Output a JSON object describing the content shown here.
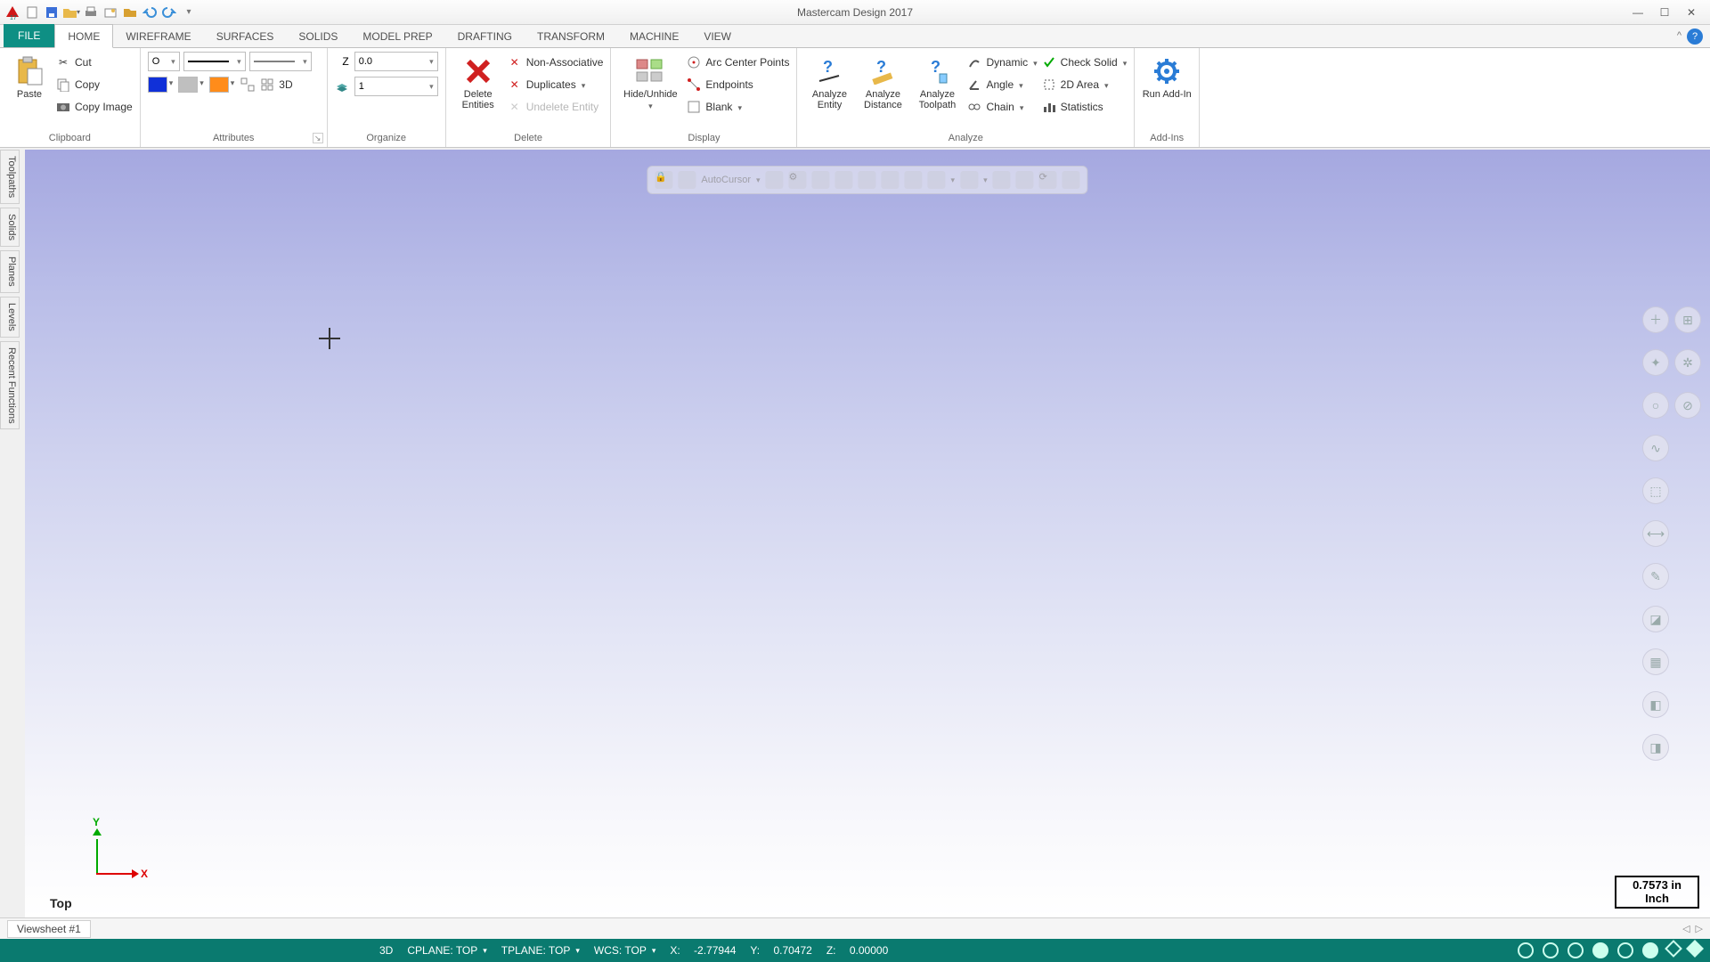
{
  "title": "Mastercam Design 2017",
  "qat": [
    "logo",
    "new",
    "save",
    "open",
    "print",
    "camera",
    "folder",
    "undo",
    "redo",
    "more"
  ],
  "win": {
    "min": "—",
    "max": "☐",
    "close": "✕"
  },
  "tabs": {
    "file": "FILE",
    "items": [
      "HOME",
      "WIREFRAME",
      "SURFACES",
      "SOLIDS",
      "MODEL PREP",
      "DRAFTING",
      "TRANSFORM",
      "MACHINE",
      "VIEW"
    ],
    "active": "HOME"
  },
  "ribbon": {
    "clipboard": {
      "label": "Clipboard",
      "paste": "Paste",
      "cut": "Cut",
      "copy": "Copy",
      "copy_image": "Copy Image"
    },
    "attributes": {
      "label": "Attributes",
      "point_style": "O",
      "threed": "3D"
    },
    "organize": {
      "label": "Organize",
      "z": "Z",
      "z_value": "0.0",
      "level_value": "1"
    },
    "delete": {
      "label": "Delete",
      "delete_entities": "Delete Entities",
      "non_assoc": "Non-Associative",
      "duplicates": "Duplicates",
      "undelete": "Undelete Entity"
    },
    "display": {
      "label": "Display",
      "hide_unhide": "Hide/Unhide",
      "arc_center": "Arc Center Points",
      "endpoints": "Endpoints",
      "blank": "Blank"
    },
    "analyze": {
      "label": "Analyze",
      "entity": "Analyze Entity",
      "distance": "Analyze Distance",
      "toolpath": "Analyze Toolpath",
      "dynamic": "Dynamic",
      "angle": "Angle",
      "chain": "Chain",
      "check_solid": "Check Solid",
      "area_2d": "2D Area",
      "statistics": "Statistics"
    },
    "addins": {
      "label": "Add-Ins",
      "run": "Run Add-In"
    }
  },
  "side_tabs": [
    "Toolpaths",
    "Solids",
    "Planes",
    "Levels",
    "Recent Functions"
  ],
  "floatbar": {
    "label": "AutoCursor"
  },
  "viewport": {
    "view_label": "Top",
    "axis_x": "X",
    "axis_y": "Y",
    "scale_value": "0.7573 in",
    "scale_unit": "Inch"
  },
  "viewsheet": {
    "tab": "Viewsheet #1"
  },
  "status": {
    "space": "",
    "mode": "3D",
    "cplane": "CPLANE: TOP",
    "tplane": "TPLANE: TOP",
    "wcs": "WCS: TOP",
    "x_label": "X:",
    "x_val": "-2.77944",
    "y_label": "Y:",
    "y_val": "0.70472",
    "z_label": "Z:",
    "z_val": "0.00000"
  }
}
